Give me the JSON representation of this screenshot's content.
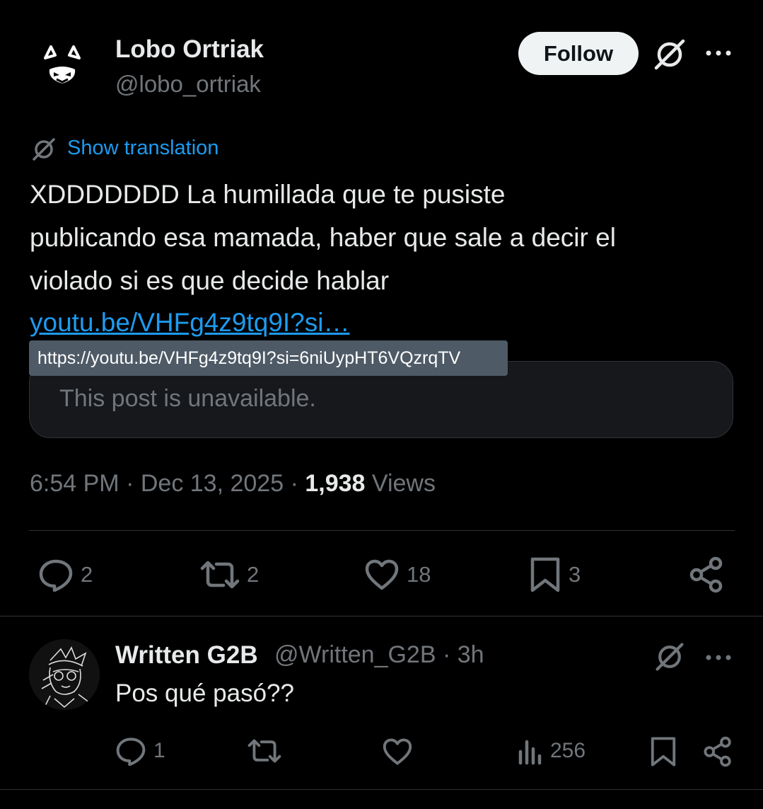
{
  "post": {
    "author_name": "Lobo Ortriak",
    "author_handle": "@lobo_ortriak",
    "follow_label": "Follow",
    "show_translation_label": "Show translation",
    "text": "XDDDDDDD La humillada que te pusiste\npublicando esa mamada, haber que sale a decir el\nviolado si es que decide hablar",
    "link_text": "youtu.be/VHFg4z9tq9I?si…",
    "link_tooltip": "https://youtu.be/VHFg4z9tq9I?si=6niUypHT6VQzrqTV",
    "quoted_unavailable": "This post is unavailable.",
    "time": "6:54 PM",
    "date": "Dec 13, 2025",
    "views_count": "1,938",
    "views_label": "Views",
    "separator": "·",
    "actions": {
      "replies": "2",
      "reposts": "2",
      "likes": "18",
      "bookmarks": "3"
    }
  },
  "reply": {
    "author_name": "Written G2B",
    "author_handle_time": "@Written_G2B · 3h",
    "text": "Pos qué pasó??",
    "actions": {
      "replies": "1",
      "views": "256"
    }
  },
  "icons": [
    "grok-icon",
    "more-icon",
    "translate-icon",
    "reply-icon",
    "repost-icon",
    "like-icon",
    "bookmark-icon",
    "share-icon",
    "analytics-icon"
  ],
  "colors": {
    "background": "#000000",
    "text": "#e7e9ea",
    "secondary": "#71767b",
    "link": "#1d9bf0",
    "follow_bg": "#eff3f4",
    "border": "#2f3336",
    "tooltip_bg": "#4e5a66"
  }
}
